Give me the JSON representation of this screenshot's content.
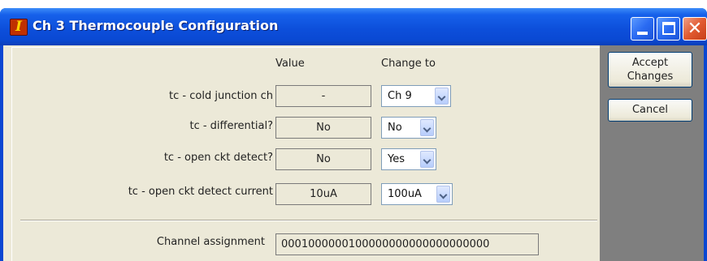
{
  "window": {
    "title": "Ch 3 Thermocouple Configuration",
    "app_icon_glyph": "I",
    "controls": [
      "minimize",
      "maximize",
      "close"
    ]
  },
  "columns": {
    "value": "Value",
    "change_to": "Change to"
  },
  "rows": [
    {
      "label": "tc - cold junction ch",
      "value": "-",
      "change_to": "Ch 9"
    },
    {
      "label": "tc - differential?",
      "value": "No",
      "change_to": "No"
    },
    {
      "label": "tc - open ckt detect?",
      "value": "No",
      "change_to": "Yes"
    },
    {
      "label": "tc - open ckt detect current",
      "value": "10uA",
      "change_to": "100uA"
    }
  ],
  "channel_assignment": {
    "label": "Channel assignment",
    "value": "0001000000100000000000000000000"
  },
  "buttons": {
    "accept_line1": "Accept",
    "accept_line2": "Changes",
    "cancel": "Cancel"
  },
  "icons": {
    "close": "✕"
  },
  "colors": {
    "titlebar": "#0a49d3",
    "client_bg": "#ece9d8",
    "close_button": "#e15a30"
  }
}
